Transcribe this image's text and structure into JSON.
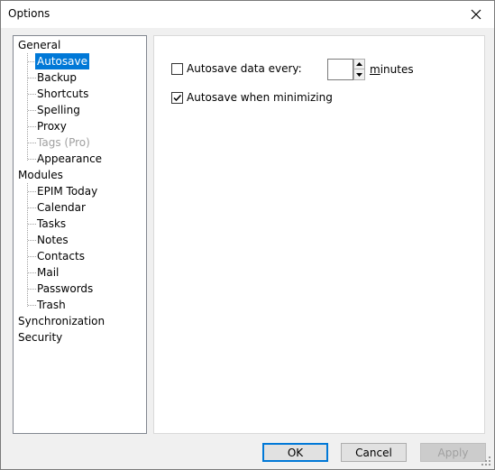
{
  "window": {
    "title": "Options",
    "close_icon": "close-icon"
  },
  "tree": {
    "items": [
      {
        "label": "General",
        "level": 0
      },
      {
        "label": "Autosave",
        "level": 1,
        "selected": true
      },
      {
        "label": "Backup",
        "level": 1
      },
      {
        "label": "Shortcuts",
        "level": 1
      },
      {
        "label": "Spelling",
        "level": 1
      },
      {
        "label": "Proxy",
        "level": 1
      },
      {
        "label": "Tags (Pro)",
        "level": 1,
        "disabled": true
      },
      {
        "label": "Appearance",
        "level": 1
      },
      {
        "label": "Modules",
        "level": 0
      },
      {
        "label": "EPIM Today",
        "level": 1
      },
      {
        "label": "Calendar",
        "level": 1
      },
      {
        "label": "Tasks",
        "level": 1
      },
      {
        "label": "Notes",
        "level": 1
      },
      {
        "label": "Contacts",
        "level": 1
      },
      {
        "label": "Mail",
        "level": 1
      },
      {
        "label": "Passwords",
        "level": 1
      },
      {
        "label": "Trash",
        "level": 1
      },
      {
        "label": "Synchronization",
        "level": 0
      },
      {
        "label": "Security",
        "level": 0
      }
    ]
  },
  "autosave": {
    "every_label": "Autosave data every:",
    "every_checked": false,
    "minutes_value": "",
    "minutes_label_first": "m",
    "minutes_label_rest": "inutes",
    "minimize_label": "Autosave when minimizing",
    "minimize_checked": true
  },
  "buttons": {
    "ok": "OK",
    "cancel": "Cancel",
    "apply": "Apply"
  },
  "colors": {
    "selection": "#0078d7"
  }
}
